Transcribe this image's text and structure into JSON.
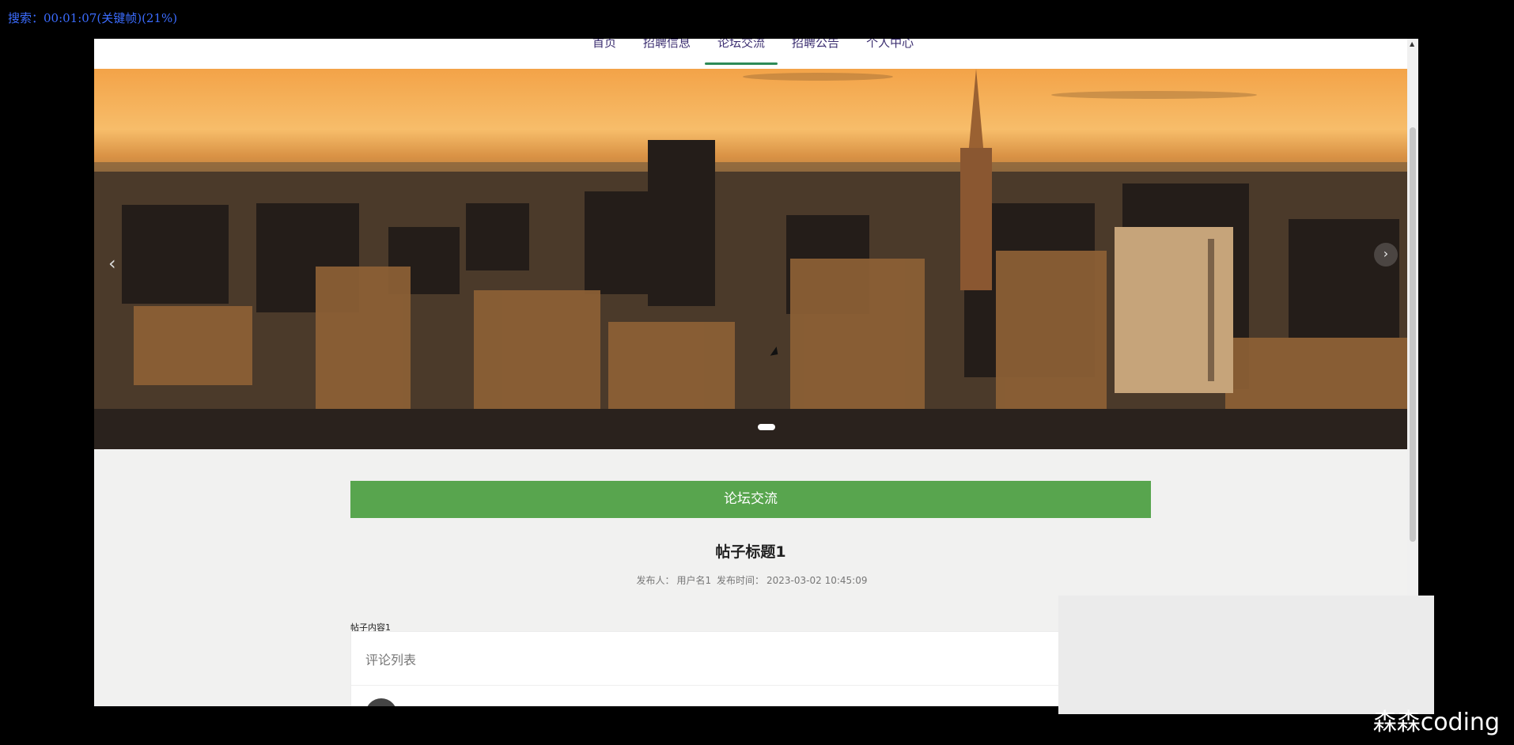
{
  "overlay": {
    "status_text": "搜索：00:01:07(关键帧)(21%)",
    "watermark": "森森coding"
  },
  "navigation": {
    "items": [
      {
        "label": "首页"
      },
      {
        "label": "招聘信息"
      },
      {
        "label": "论坛交流"
      },
      {
        "label": "招聘公告"
      },
      {
        "label": "个人中心"
      }
    ],
    "active_item": "论坛交流",
    "active_color": "#2e8b57"
  },
  "hero": {
    "left_arrow": "‹",
    "right_arrow": "›",
    "active_slide": 1
  },
  "forum": {
    "banner_title": "论坛交流",
    "banner_color": "#58a54e",
    "post_title": "帖子标题1",
    "author_label": "发布人：",
    "author": "用户名1",
    "time_label": "发布时间：",
    "time": "2023-03-02 10:45:09",
    "content": "帖子内容1",
    "comments_title": "评论列表"
  },
  "icons": {
    "cursor": "mouse-cursor-icon",
    "avatar": "user-avatar-icon"
  }
}
